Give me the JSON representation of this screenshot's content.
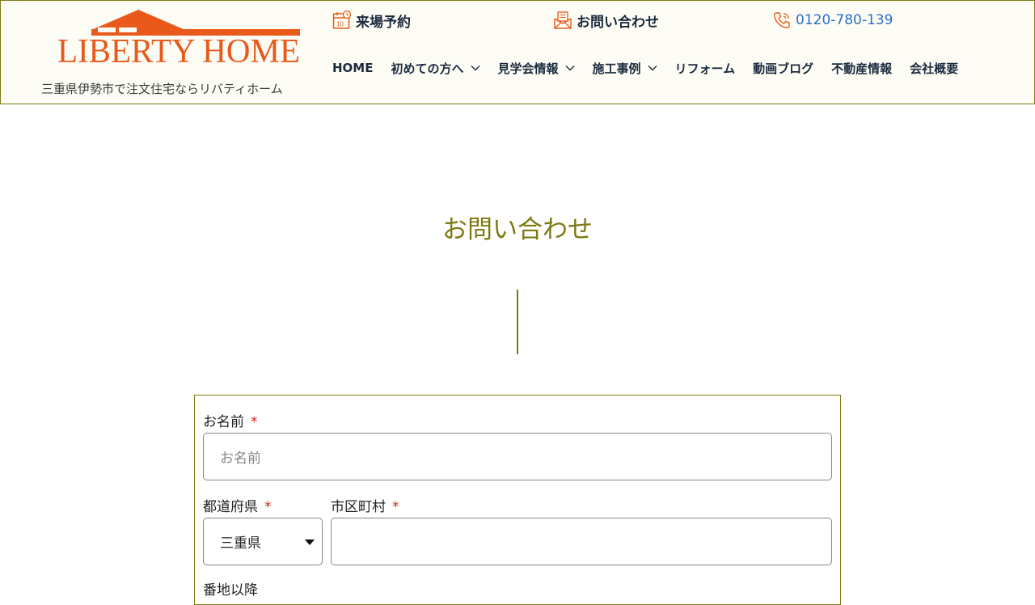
{
  "brand": {
    "logo_text": "LIBERTY HOME",
    "logo_color": "#e8591a",
    "tagline": "三重県伊勢市で注文住宅ならリバティホーム"
  },
  "top_links": {
    "reserve": {
      "label": "来場予約",
      "icon": "calendar-icon"
    },
    "contact": {
      "label": "お問い合わせ",
      "icon": "mail-icon"
    },
    "phone": {
      "label": "0120-780-139",
      "icon": "phone-icon"
    }
  },
  "nav": {
    "items": [
      {
        "label": "HOME",
        "dropdown": false
      },
      {
        "label": "初めての方へ",
        "dropdown": true
      },
      {
        "label": "見学会情報",
        "dropdown": true
      },
      {
        "label": "施工事例",
        "dropdown": true
      },
      {
        "label": "リフォーム",
        "dropdown": false
      },
      {
        "label": "動画ブログ",
        "dropdown": false
      },
      {
        "label": "不動産情報",
        "dropdown": false
      },
      {
        "label": "会社概要",
        "dropdown": false
      }
    ]
  },
  "main": {
    "title": "お問い合わせ"
  },
  "form": {
    "name": {
      "label": "お名前",
      "required": "*",
      "placeholder": "お名前",
      "value": ""
    },
    "prefecture": {
      "label": "都道府県",
      "required": "*",
      "value": "三重県"
    },
    "city": {
      "label": "市区町村",
      "required": "*",
      "value": ""
    },
    "next_label": "番地以降"
  },
  "colors": {
    "accent": "#7d7a12",
    "brand_orange": "#e8591a",
    "nav_text": "#1b2a3d",
    "phone_link": "#2a6fc7",
    "required": "#d3201f"
  }
}
